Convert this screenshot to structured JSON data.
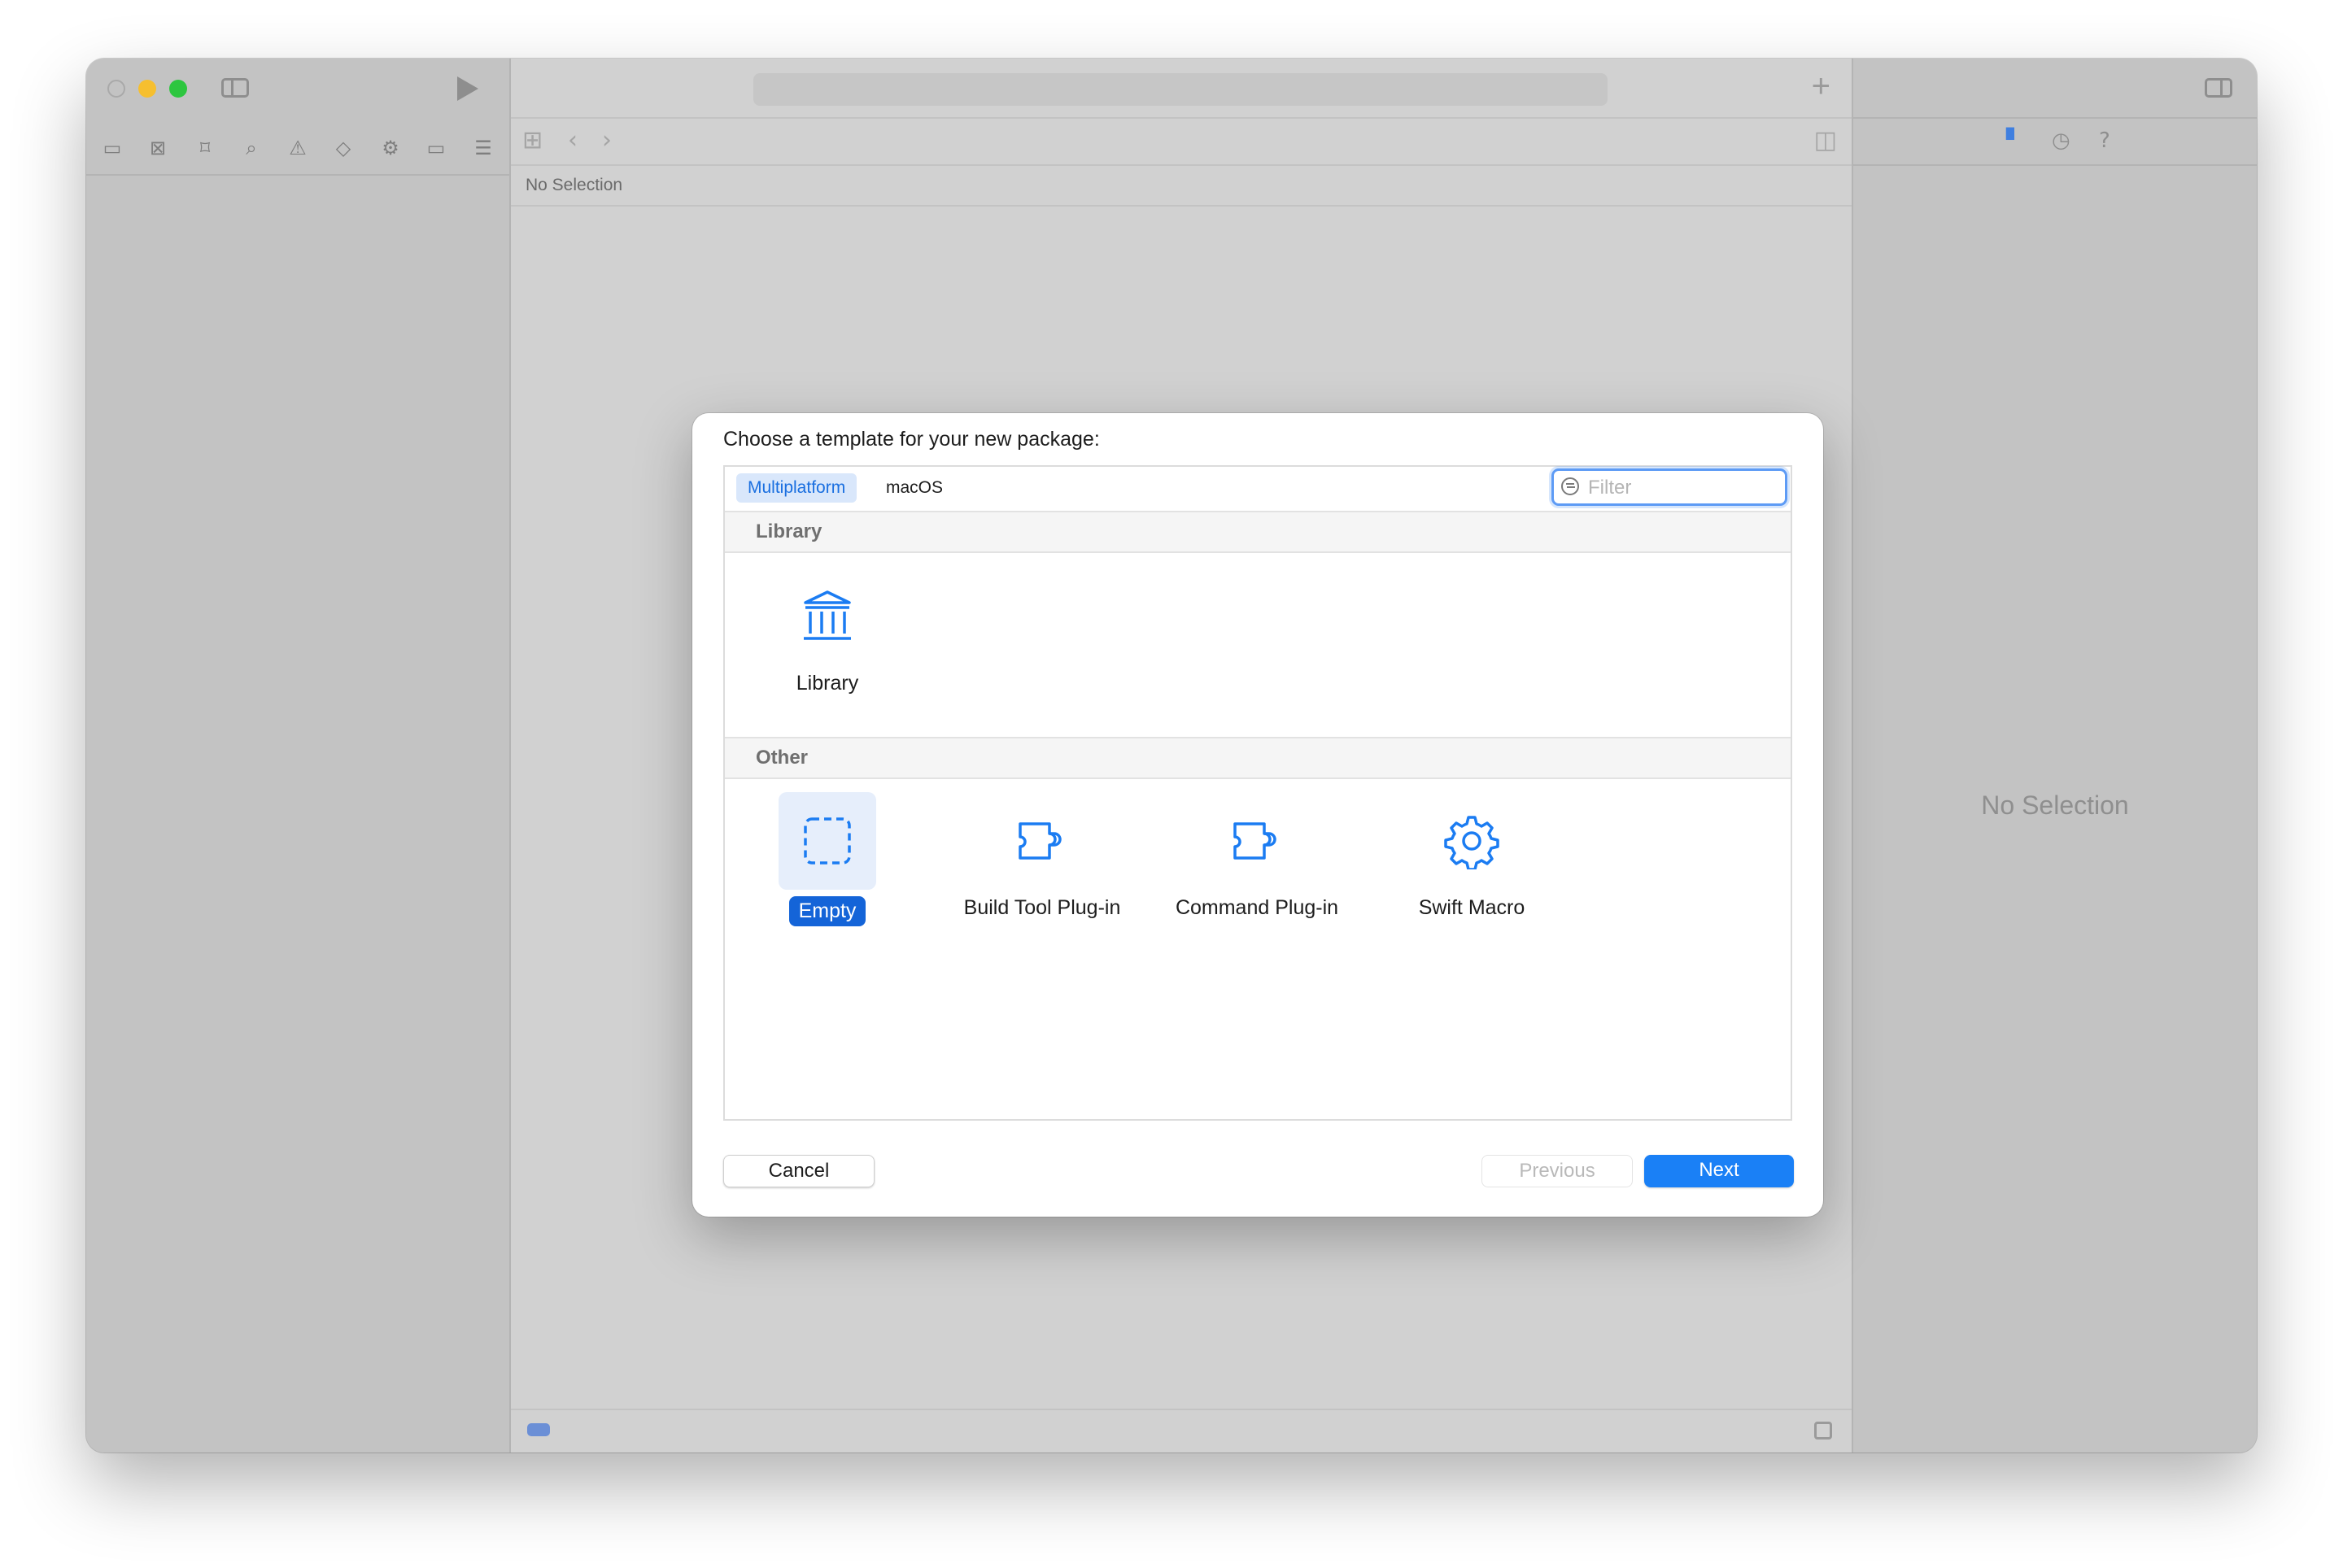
{
  "toolbar": {
    "run_icon": "play-icon",
    "sidebar_toggle_icon": "sidebar-left-icon",
    "add_icon": "plus-icon",
    "add_label": "+",
    "inspector_toggle_icon": "sidebar-right-icon"
  },
  "navigator_icons": [
    {
      "name": "folder-icon",
      "glyph": "▭"
    },
    {
      "name": "source-control-icon",
      "glyph": "⊠"
    },
    {
      "name": "bookmark-icon",
      "glyph": "⌑"
    },
    {
      "name": "search-icon",
      "glyph": "⌕"
    },
    {
      "name": "warning-icon",
      "glyph": "⚠"
    },
    {
      "name": "test-icon",
      "glyph": "◇"
    },
    {
      "name": "debug-icon",
      "glyph": "⚙"
    },
    {
      "name": "breakpoint-icon",
      "glyph": "▭"
    },
    {
      "name": "report-icon",
      "glyph": "☰"
    }
  ],
  "editor": {
    "jump_bar_text": "No Selection",
    "grid_glyph": "⊞",
    "back_glyph": "‹",
    "forward_glyph": "›",
    "split_glyph": "◫"
  },
  "inspector": {
    "tabs": [
      {
        "name": "file-inspector-icon",
        "glyph": "▘",
        "active": true
      },
      {
        "name": "history-icon",
        "glyph": "◷",
        "active": false
      },
      {
        "name": "help-icon",
        "glyph": "?",
        "active": false
      }
    ],
    "no_selection": "No Selection"
  },
  "dialog": {
    "title": "Choose a template for your new package:",
    "tabs": [
      {
        "label": "Multiplatform",
        "selected": true
      },
      {
        "label": "macOS",
        "selected": false
      }
    ],
    "filter": {
      "placeholder": "Filter",
      "value": ""
    },
    "sections": [
      {
        "header": "Library",
        "templates": [
          {
            "label": "Library",
            "icon": "building-columns-icon",
            "selected": false
          }
        ]
      },
      {
        "header": "Other",
        "templates": [
          {
            "label": "Empty",
            "icon": "dashed-square-icon",
            "selected": true
          },
          {
            "label": "Build Tool Plug-in",
            "icon": "puzzle-piece-icon",
            "selected": false
          },
          {
            "label": "Command Plug-in",
            "icon": "puzzle-piece-icon",
            "selected": false
          },
          {
            "label": "Swift Macro",
            "icon": "gear-icon",
            "selected": false
          }
        ]
      }
    ],
    "buttons": {
      "cancel": "Cancel",
      "previous": "Previous",
      "next": "Next"
    }
  },
  "colors": {
    "accent": "#1a80f6",
    "selection": "#1464d8",
    "icon_blue": "#1b7cf2"
  }
}
